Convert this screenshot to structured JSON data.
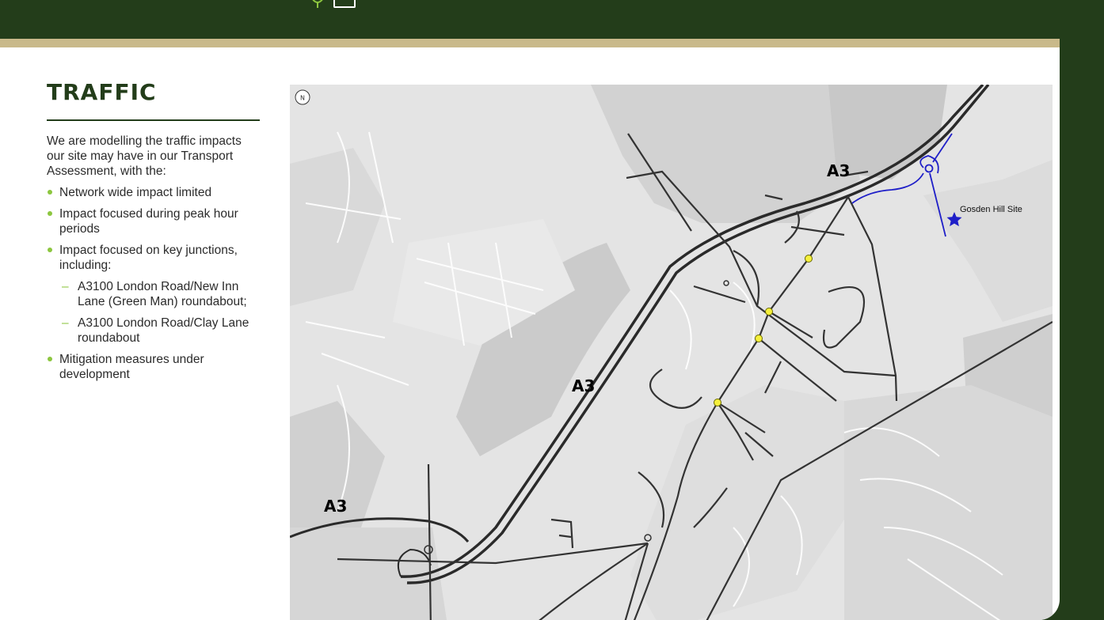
{
  "section": {
    "title": "TRAFFIC",
    "intro": "We are modelling the traffic impacts our site may have in our Transport Assessment, with the:",
    "bullets": [
      "Network wide impact limited",
      "Impact focused during peak hour periods",
      "Impact focused on key junctions, including:",
      "Mitigation measures under development"
    ],
    "sub_bullets": [
      "A3100 London Road/New Inn Lane (Green Man) roundabout;",
      "A3100 London Road/Clay Lane roundabout"
    ]
  },
  "map": {
    "road_labels": [
      "A3",
      "A3",
      "A3"
    ],
    "site_label": "Gosden Hill Site",
    "north_marker": "N",
    "junction_count": 4,
    "colors": {
      "site_access": "#1f1fc8",
      "junction_marker": "#f5f03c",
      "background": "#e4e4e4",
      "roads": "#3a3a3a",
      "header": "#233d1a",
      "accent_strip": "#c9b98a",
      "bullet": "#8cc63f"
    }
  },
  "header": {
    "icons": [
      "leaf-icon",
      "frame-icon"
    ]
  }
}
